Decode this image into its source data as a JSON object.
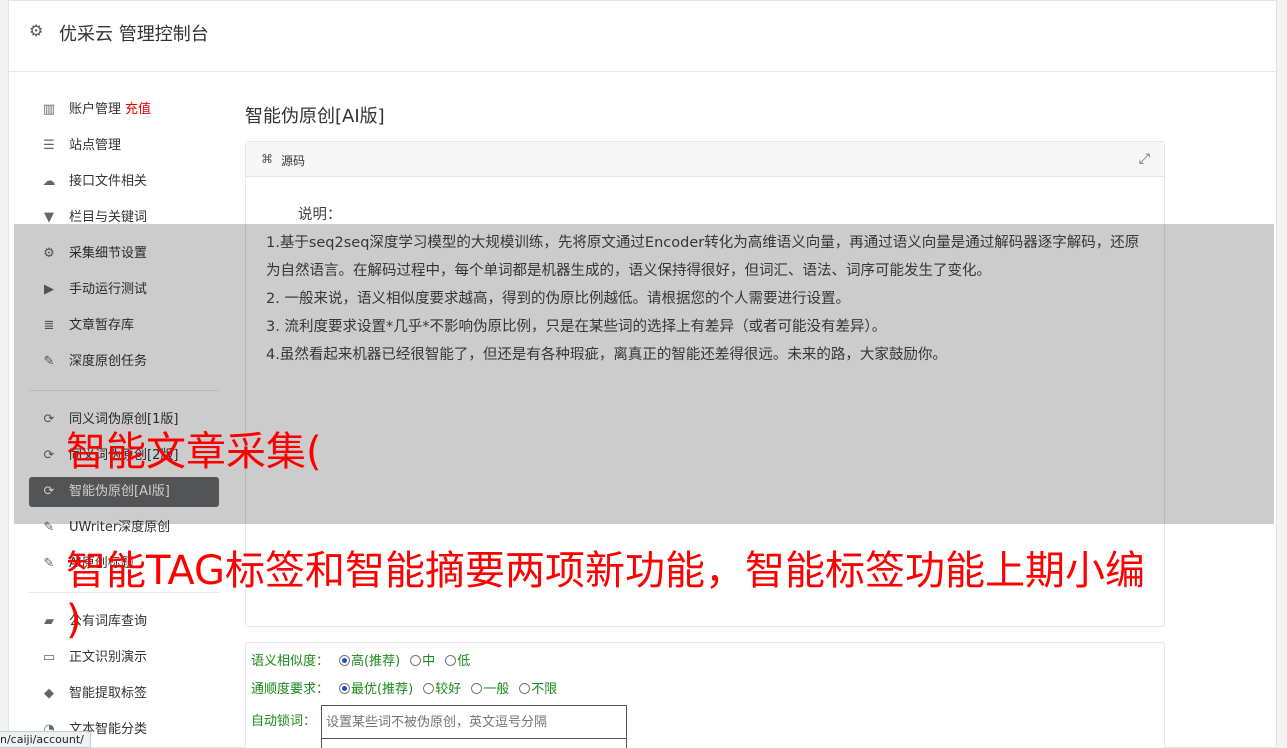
{
  "header": {
    "logo_icon": "gear-icon",
    "title": "优采云 管理控制台"
  },
  "sidebar": {
    "items": [
      {
        "icon": "bar-chart-icon",
        "glyph": "▥",
        "label": "账户管理",
        "badge": "充值"
      },
      {
        "icon": "server-icon",
        "glyph": "☰",
        "label": "站点管理"
      },
      {
        "icon": "cloud-upload-icon",
        "glyph": "☁",
        "label": "接口文件相关"
      },
      {
        "icon": "filter-icon",
        "glyph": "▼",
        "label": "栏目与关键词"
      },
      {
        "icon": "cogs-icon",
        "glyph": "⚙",
        "label": "采集细节设置"
      },
      {
        "icon": "play-circle-icon",
        "glyph": "▶",
        "label": "手动运行测试"
      },
      {
        "icon": "database-icon",
        "glyph": "≣",
        "label": "文章暂存库"
      },
      {
        "icon": "edit-icon",
        "glyph": "✎",
        "label": "深度原创任务"
      }
    ],
    "items2": [
      {
        "icon": "refresh-icon",
        "glyph": "⟳",
        "label": "同义词伪原创[1版]"
      },
      {
        "icon": "refresh-icon",
        "glyph": "⟳",
        "label": "同义词伪原创[2版]"
      },
      {
        "icon": "refresh-icon",
        "glyph": "⟳",
        "label": "智能伪原创[AI版]"
      },
      {
        "icon": "edit-icon",
        "glyph": "✎",
        "label": "UWriter深度原创"
      },
      {
        "icon": "edit-icon",
        "glyph": "✎",
        "label": "AI原创标题"
      }
    ],
    "items3": [
      {
        "icon": "book-icon",
        "glyph": "▰",
        "label": "公有词库查询"
      },
      {
        "icon": "monitor-icon",
        "glyph": "▭",
        "label": "正文识别演示"
      },
      {
        "icon": "tag-icon",
        "glyph": "◆",
        "label": "智能提取标签"
      },
      {
        "icon": "pie-chart-icon",
        "glyph": "◔",
        "label": "文本智能分类"
      }
    ]
  },
  "main": {
    "page_title": "智能伪原创[AI版]",
    "panel": {
      "header_icon": "file-code-icon",
      "header_label": "源码",
      "expand_icon": "expand-icon",
      "notes_title": "说明：",
      "notes": [
        "1.基于seq2seq深度学习模型的大规模训练，先将原文通过Encoder转化为高维语义向量，再通过语义向量是通过解码器逐字解码，还原为自然语言。在解码过程中，每个单词都是机器生成的，语义保持得很好，但词汇、语法、词序可能发生了变化。",
        "2. 一般来说，语义相似度要求越高，得到的伪原比例越低。请根据您的个人需要进行设置。",
        "3. 流利度要求设置*几乎*不影响伪原比例，只是在某些词的选择上有差异（或者可能没有差异）。",
        "4.虽然看起来机器已经很智能了，但还是有各种瑕疵，离真正的智能还差得很远。未来的路，大家鼓励你。"
      ]
    },
    "form": {
      "similarity": {
        "label": "语义相似度：",
        "options": [
          "高(推荐)",
          "中",
          "低"
        ],
        "selected": "高(推荐)"
      },
      "fluency": {
        "label": "通顺度要求：",
        "options": [
          "最优(推荐)",
          "较好",
          "一般",
          "不限"
        ],
        "selected": "最优(推荐)"
      },
      "auto_lock": {
        "label": "自动锁词：",
        "placeholder": "设置某些词不被伪原创，英文逗号分隔",
        "value": ""
      }
    }
  },
  "overlay_text": {
    "line1": "智能文章采集(",
    "line2": "智能TAG标签和智能摘要两项新功能，智能标签功能上期小编",
    "line3": ")"
  },
  "statusbar": {
    "url": "n/caiji/account/"
  }
}
